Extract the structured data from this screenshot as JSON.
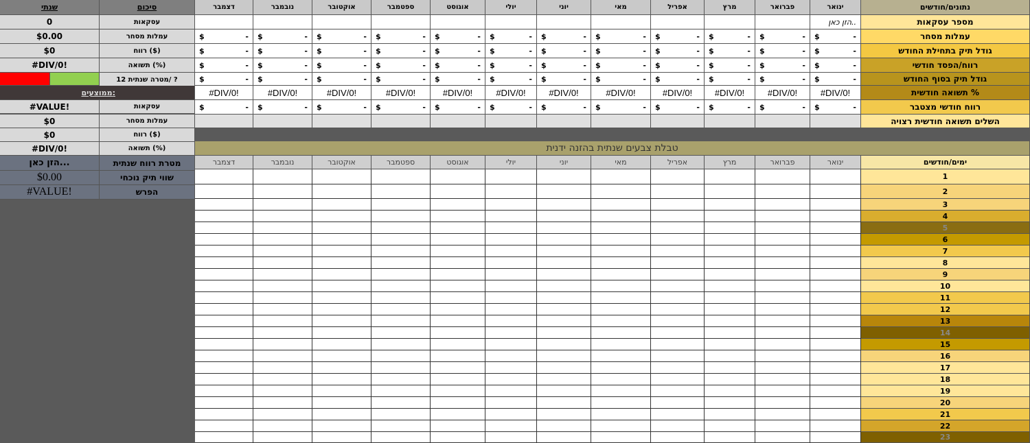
{
  "months": [
    "ינואר",
    "פברואר",
    "מרץ",
    "אפריל",
    "מאי",
    "יוני",
    "יולי",
    "אוגוסט",
    "ספטמבר",
    "אוקטובר",
    "נובמבר",
    "דצמבר"
  ],
  "right_header": "נתונים/חודשים",
  "right_labels": [
    "מספר עסקאות",
    "עמלות מסחר",
    "גודל תיק בתחילת החודש",
    "רווח/הפסד חודשי",
    "גודל תיק בסוף החודש",
    "תשואה חודשית %",
    "רווח חודשי מצטבר",
    "השלים תשואה חודשית רצויה"
  ],
  "enter_placeholder": "הזן כאן..",
  "money_symbol": "$",
  "money_dash": "-",
  "div_error": "#DIV/0!",
  "summary": {
    "col_yearly": "שנתי",
    "col_summary": "סיכום",
    "rows": [
      {
        "label": "עסקאות",
        "value": "0"
      },
      {
        "label": "עמלות מסחר",
        "value": "$0.00"
      },
      {
        "label": "רווח ($)",
        "value": "$0"
      },
      {
        "label": "תשואה (%)",
        "value": "#DIV/0!"
      },
      {
        "label": "מטרה שנתית 12/ ?",
        "value": ""
      }
    ],
    "averages_label": "ממוצעים:",
    "avg_rows": [
      {
        "label": "עסקאות",
        "value": "#VALUE!"
      },
      {
        "label": "עמלות מסחר",
        "value": "$0"
      },
      {
        "label": "רווח ($)",
        "value": "$0"
      },
      {
        "label": "תשואה (%)",
        "value": "#DIV/0!"
      }
    ],
    "target_label": "מטרת רווח שנתית",
    "target_value": "הזן כאן...",
    "current_label": "שווי תיק נוכחי",
    "current_value": "$0.00",
    "diff_label": "הפרש",
    "diff_value": "#VALUE!"
  },
  "color_table_title": "טבלת צבעים שנתית בהזנה ידנית",
  "days_header": "ימים/חודשים",
  "days": [
    "1",
    "2",
    "3",
    "4",
    "5",
    "6",
    "7",
    "8",
    "9",
    "10",
    "11",
    "12",
    "13",
    "14",
    "15",
    "16",
    "17",
    "18",
    "19",
    "20",
    "21",
    "22",
    "23"
  ],
  "colors": {
    "goal_red": "#ff0000",
    "goal_green": "#92d050",
    "row_shades": [
      "#ffe699",
      "#f7d47a",
      "#f2c94c",
      "#c49a00",
      "#9b7a17",
      "#7f6000",
      "#bfa24a"
    ]
  }
}
